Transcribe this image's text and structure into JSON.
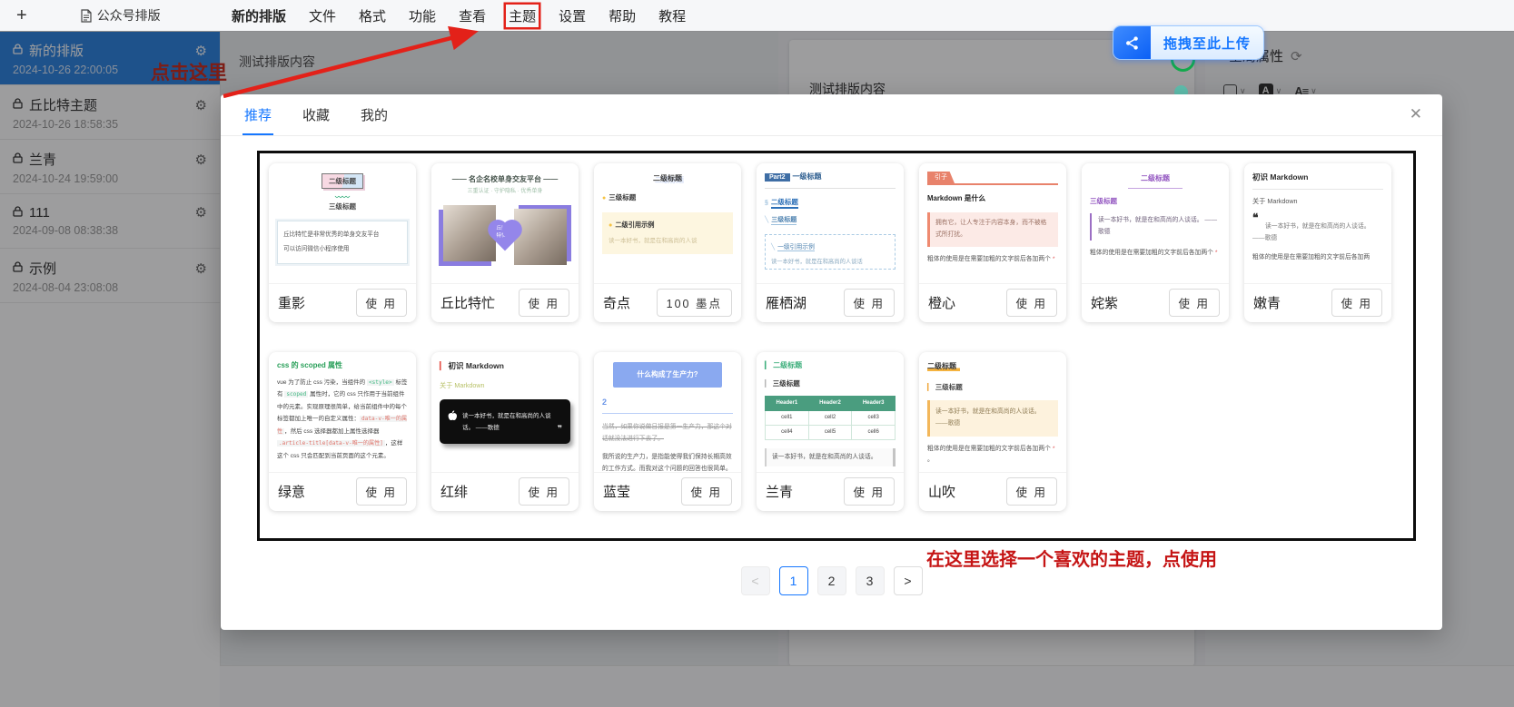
{
  "topbar": {
    "app_name": "公众号排版",
    "menu": [
      "新的排版",
      "文件",
      "格式",
      "功能",
      "查看",
      "主题",
      "设置",
      "帮助",
      "教程"
    ]
  },
  "sidebar": {
    "items": [
      {
        "title": "新的排版",
        "date": "2024-10-26 22:00:05",
        "selected": true
      },
      {
        "title": "丘比特主题",
        "date": "2024-10-26 18:58:35",
        "selected": false
      },
      {
        "title": "兰青",
        "date": "2024-10-24 19:59:00",
        "selected": false
      },
      {
        "title": "111",
        "date": "2024-09-08 08:38:38",
        "selected": false
      },
      {
        "title": "示例",
        "date": "2024-08-04 23:08:08",
        "selected": false
      }
    ]
  },
  "editor": {
    "sample_text": "测试排版内容"
  },
  "preview_pane": {
    "sample_text": "测试排版内容"
  },
  "right_panel": {
    "global_props_label": "全局属性",
    "font_color_letter": "A",
    "font_size_letter": "A≡"
  },
  "upload_badge": {
    "label": "拖拽至此上传"
  },
  "annotations": {
    "click_here": "点击这里",
    "choose_theme": "在这里选择一个喜欢的主题，点使用"
  },
  "icons": {
    "plus": "+",
    "refresh": "⟳",
    "close": "✕",
    "gear": "⚙",
    "chevron_down": "∨",
    "prev": "<",
    "next": ">"
  },
  "modal": {
    "tabs": [
      {
        "label": "推荐",
        "active": true
      },
      {
        "label": "收藏",
        "active": false
      },
      {
        "label": "我的",
        "active": false
      }
    ],
    "pagination": {
      "prev": "<",
      "pages": [
        {
          "label": "1",
          "active": true
        },
        {
          "label": "2",
          "active": false
        },
        {
          "label": "3",
          "active": false
        }
      ],
      "next": ">"
    },
    "cards": [
      {
        "name": "重影",
        "action": "使 用",
        "blocks": [
          {
            "k": "t",
            "cls": "zy-badge",
            "t": "二级标题"
          },
          {
            "k": "t",
            "cls": "zy-h3",
            "pre": "〰〰",
            "t": "三级标题"
          },
          {
            "k": "box",
            "cls": "zy-box",
            "lines": [
              {
                "t": "丘比特忙是非常优秀的单身交友平台"
              },
              {
                "t": "可以访问微信小程序使用"
              }
            ]
          }
        ]
      },
      {
        "name": "丘比特忙",
        "action": "使 用",
        "blocks": [
          {
            "k": "t",
            "cls": "qbt-h1",
            "t": "—— 名企名校单身交友平台 ——"
          },
          {
            "k": "t",
            "cls": "qbt-sub",
            "t": "三重认证 · 守护隐私 · 优秀单身"
          },
          {
            "k": "photo",
            "heart": [
              "丘比",
              "特忙"
            ]
          }
        ]
      },
      {
        "name": "奇点",
        "action": "100 墨点",
        "blocks": [
          {
            "k": "t",
            "cls": "qd-h2",
            "t": "二级标题"
          },
          {
            "k": "t",
            "cls": "qd-h3",
            "pre": "●",
            "t": "三级标题"
          },
          {
            "k": "box",
            "cls": "qd-box",
            "lines": [
              {
                "t": "二级引用示例",
                "pre": "●",
                "cls": "qd-box-title"
              },
              {
                "t": "读一本好书，就是在和高尚的人谈",
                "cls": "qd-box-text"
              }
            ]
          }
        ]
      },
      {
        "name": "雁栖湖",
        "action": "使 用",
        "blocks": [
          {
            "k": "t",
            "cls": "yqh-h1",
            "pre": "Part2",
            "t": "一级标题"
          },
          {
            "k": "t",
            "cls": "yqh-h2",
            "pre": "§",
            "t": "二级标题"
          },
          {
            "k": "t",
            "cls": "yqh-h3",
            "pre": "╲",
            "t": "三级标题"
          },
          {
            "k": "box",
            "cls": "yqh-box",
            "lines": [
              {
                "t": "一级引用示例",
                "pre": "╲",
                "cls": "yqh-box-title"
              },
              {
                "t": "读一本好书，就是在和高尚的人谈话",
                "cls": "yqh-box-text"
              }
            ]
          }
        ]
      },
      {
        "name": "橙心",
        "action": "使 用",
        "blocks": [
          {
            "k": "t",
            "cls": "cx-tab",
            "pre": "引子",
            "t": ""
          },
          {
            "k": "t",
            "cls": "cx-h4",
            "t": "Markdown 是什么"
          },
          {
            "k": "t",
            "cls": "cx-quote",
            "t": "拥有它，让人专注于内容本身，而不被格式所打扰。"
          },
          {
            "k": "rich",
            "cls": "tp-p",
            "parts": [
              {
                "t": "粗体的使用是在需要加粗的文字前后各加两个 "
              },
              {
                "t": "*",
                "c": "red"
              }
            ]
          }
        ]
      },
      {
        "name": "姹紫",
        "action": "使 用",
        "blocks": [
          {
            "k": "t",
            "cls": "cz-h2",
            "t": "二级标题"
          },
          {
            "k": "t",
            "cls": "cz-h3",
            "t": "三级标题"
          },
          {
            "k": "t",
            "cls": "cz-quote",
            "t": "读一本好书，就是在和高尚的人谈话。 ——歌德"
          },
          {
            "k": "rich",
            "cls": "tp-p",
            "parts": [
              {
                "t": "粗体的使用是在需要加粗的文字前后各加两个 "
              },
              {
                "t": "*",
                "c": "red"
              }
            ]
          }
        ]
      },
      {
        "name": "嫩青",
        "action": "使 用",
        "blocks": [
          {
            "k": "t",
            "cls": "nq-h1",
            "t": "初识 Markdown"
          },
          {
            "k": "t",
            "cls": "nq-h4",
            "t": "关于 Markdown"
          },
          {
            "k": "bigquote",
            "t": "读一本好书，就是在和高尚的人谈话。 ——歌德"
          },
          {
            "k": "t",
            "cls": "tp-p",
            "t": "粗体的使用是在需要加粗的文字前后各加两"
          }
        ]
      },
      {
        "name": "绿意",
        "action": "使 用",
        "blocks": [
          {
            "k": "t",
            "cls": "lv-h",
            "t": "css 的 scoped 属性"
          },
          {
            "k": "rich",
            "cls": "lv-body",
            "parts": [
              {
                "t": "vue 为了防止 css 污染，当组件的 "
              },
              {
                "t": "<style>",
                "c": "g"
              },
              {
                "t": " 标签有 "
              },
              {
                "t": "scoped",
                "c": "g"
              },
              {
                "t": " 属性时，它的 css 只作用于当前组件中的元素。实现原理很简单，给当前组件中的每个标签都加上唯一的自定义属性："
              },
              {
                "t": "data-v-唯一的属性",
                "c": "r"
              },
              {
                "t": "，然后 css 选择器都加上属性选择器 "
              },
              {
                "t": ".article-title[data-v-唯一的属性]",
                "c": "r"
              },
              {
                "t": "，这样这个 css 只会匹配到当前页面的这个元素。"
              }
            ]
          }
        ]
      },
      {
        "name": "红绯",
        "action": "使 用",
        "blocks": [
          {
            "k": "t",
            "cls": "hf-h1",
            "pre": "▎",
            "t": "初识 Markdown"
          },
          {
            "k": "t",
            "cls": "hf-h4",
            "t": "关于 Markdown"
          },
          {
            "k": "blackcard",
            "t": "读一本好书，就是在和高尚的人谈话。 ——歌德"
          }
        ]
      },
      {
        "name": "蓝莹",
        "action": "使 用",
        "blocks": [
          {
            "k": "t",
            "cls": "ly-box",
            "t": "什么构成了生产力?"
          },
          {
            "k": "t",
            "cls": "ly-h2",
            "t": "2"
          },
          {
            "k": "t",
            "cls": "ly-strike",
            "t": "当然，如果你说做日报是第一生产力，那这个对话就没法进行下去了。"
          },
          {
            "k": "t",
            "cls": "ly-p",
            "t": "我所说的生产力，是指能使得我们保持长期高效的工作方式。而我对这个问题的回答也很简单。"
          }
        ]
      },
      {
        "name": "兰青",
        "action": "使 用",
        "blocks": [
          {
            "k": "t",
            "cls": "lq-h2",
            "pre": "▎",
            "t": "二级标题"
          },
          {
            "k": "t",
            "cls": "lq-h3",
            "pre": "▎",
            "t": "三级标题"
          },
          {
            "k": "table",
            "headers": [
              "Header1",
              "Header2",
              "Header3"
            ],
            "rows": [
              [
                "cell1",
                "cell2",
                "cell3"
              ],
              [
                "cell4",
                "cell5",
                "cell6"
              ]
            ]
          },
          {
            "k": "t",
            "cls": "lq-quote",
            "t": "读一本好书，就是在和高尚的人谈话。"
          }
        ]
      },
      {
        "name": "山吹",
        "action": "使 用",
        "blocks": [
          {
            "k": "t",
            "cls": "sc-h2",
            "t": "二级标题"
          },
          {
            "k": "t",
            "cls": "sc-h3",
            "pre": "▎",
            "t": "三级标题"
          },
          {
            "k": "t",
            "cls": "sc-quote",
            "t": "读一本好书，就是在和高尚的人谈话。 ——歌德"
          },
          {
            "k": "rich",
            "cls": "tp-p",
            "parts": [
              {
                "t": "粗体的使用是在需要加粗的文字前后各加两个 "
              },
              {
                "t": "*",
                "c": "red"
              },
              {
                "t": " 。"
              }
            ]
          }
        ]
      }
    ]
  },
  "colors": {
    "accent_blue": "#1677ff",
    "annotation_red": "#e32119",
    "selected_item_bg": "#2c82e0",
    "upload_badge_blue": "#0b60f5",
    "green_ring": "#12a94c"
  }
}
